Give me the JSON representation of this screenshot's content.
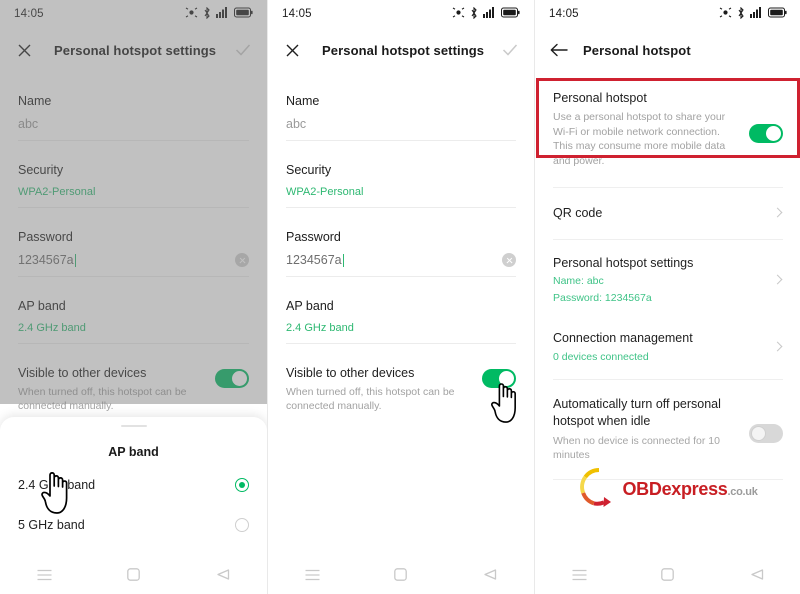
{
  "status_bar": {
    "time": "14:05",
    "icons": [
      "nfc-icon",
      "bluetooth-icon",
      "signal-bars-icon",
      "battery-icon"
    ]
  },
  "nav_bar": {
    "recents_label": "recents-button",
    "home_label": "home-button",
    "back_label": "back-button"
  },
  "panel1": {
    "appbar": {
      "close_label": "✕",
      "title": "Personal hotspot settings",
      "confirm_label": "✓"
    },
    "name": {
      "label": "Name",
      "value": "abc"
    },
    "security": {
      "label": "Security",
      "value": "WPA2-Personal"
    },
    "password": {
      "label": "Password",
      "value": "1234567a"
    },
    "ap_band": {
      "label": "AP band",
      "value": "2.4 GHz band"
    },
    "visible": {
      "title": "Visible to other devices",
      "desc": "When turned off, this hotspot can be connected manually.",
      "toggle_state": "on"
    },
    "sheet": {
      "title": "AP band",
      "options": [
        {
          "label": "2.4 GHz band",
          "selected": true
        },
        {
          "label": "5 GHz band",
          "selected": false
        }
      ]
    }
  },
  "panel2": {
    "appbar": {
      "close_label": "✕",
      "title": "Personal hotspot settings",
      "confirm_label": "✓"
    },
    "name": {
      "label": "Name",
      "value": "abc"
    },
    "security": {
      "label": "Security",
      "value": "WPA2-Personal"
    },
    "password": {
      "label": "Password",
      "value": "1234567a"
    },
    "ap_band": {
      "label": "AP band",
      "value": "2.4 GHz band"
    },
    "visible": {
      "title": "Visible to other devices",
      "desc": "When turned off, this hotspot can be connected manually.",
      "toggle_state": "on"
    }
  },
  "panel3": {
    "appbar": {
      "back_label": "←",
      "title": "Personal hotspot"
    },
    "hotspot": {
      "title": "Personal hotspot",
      "desc": "Use a personal hotspot to share your Wi-Fi or mobile network connection. This may consume more mobile data and power.",
      "toggle_state": "on",
      "highlight_color": "#cf2130"
    },
    "qr_code": {
      "title": "QR code"
    },
    "hotspot_settings": {
      "title": "Personal hotspot settings",
      "sub_name": "Name: abc",
      "sub_password": "Password: 1234567a"
    },
    "connection_management": {
      "title": "Connection management",
      "sub": "0 devices connected"
    },
    "auto_off": {
      "title": "Automatically turn off personal hotspot when idle",
      "desc": "When no device is connected for 10 minutes",
      "toggle_state": "off"
    },
    "watermark": {
      "brand": "OBD",
      "brand2": "express",
      "tld": ".co.uk"
    }
  },
  "colors": {
    "accent_green": "#00ba63",
    "link_green": "#2eb872",
    "highlight_red": "#cf2130"
  }
}
